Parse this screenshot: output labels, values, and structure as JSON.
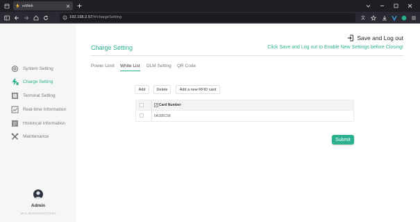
{
  "browser": {
    "tab_title": "evWeb",
    "url_host": "192.168.2.57",
    "url_path": "/#/chargeSetting"
  },
  "sidebar": {
    "items": [
      {
        "label": "System Setting",
        "icon": "gear-icon"
      },
      {
        "label": "Charge Setting",
        "icon": "charging-icon"
      },
      {
        "label": "Terminal Setting",
        "icon": "terminal-icon"
      },
      {
        "label": "Real-time Information",
        "icon": "chart-icon"
      },
      {
        "label": "Historical Information",
        "icon": "history-icon"
      },
      {
        "label": "Maintenance",
        "icon": "tools-icon"
      }
    ],
    "active_index": 1,
    "user": "Admin",
    "mac": "MAC:98:D8:8H:E3:C8:3A"
  },
  "header": {
    "save_logout": "Save and Log out",
    "title": "Charge Setting",
    "notice": "Click Save and Log out to Enable New Settings before Closing!"
  },
  "tabs": [
    "Power Limit",
    "White List",
    "DLM Setting",
    "QR Code"
  ],
  "active_tab": 1,
  "buttons": {
    "add": "Add",
    "delete": "Delete",
    "add_rfid": "Add a new RFID card",
    "submit": "Submit"
  },
  "table": {
    "header": "Card Number",
    "rows": [
      "0A395C58"
    ]
  },
  "colors": {
    "accent": "#2bb08f",
    "sidebar_bg": "#f6f6f6",
    "browser_chrome": "#1f1f23"
  }
}
